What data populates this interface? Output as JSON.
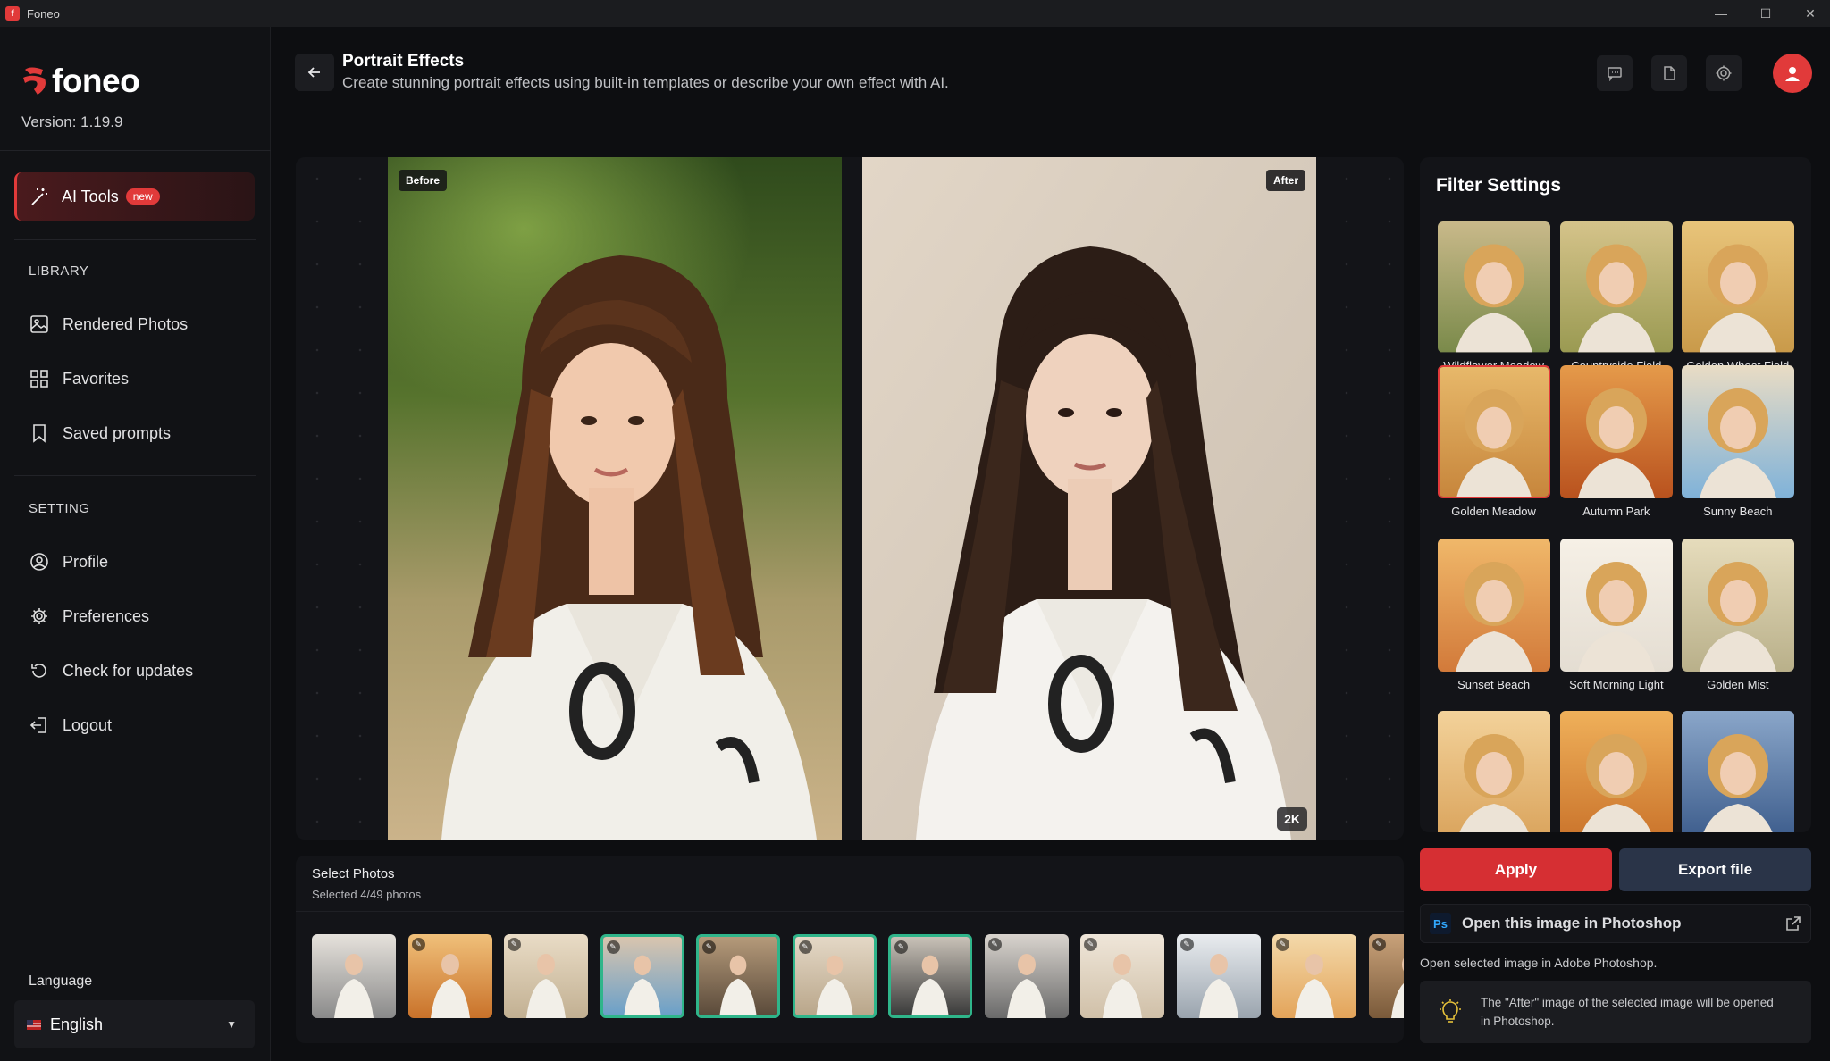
{
  "window": {
    "title": "Foneo"
  },
  "sidebar": {
    "logo_text": "foneo",
    "version": "Version: 1.19.9",
    "ai_tools": {
      "label": "AI Tools",
      "badge": "new"
    },
    "library_heading": "LIBRARY",
    "library_items": [
      {
        "label": "Rendered Photos",
        "icon": "image-icon"
      },
      {
        "label": "Favorites",
        "icon": "grid-icon"
      },
      {
        "label": "Saved prompts",
        "icon": "bookmark-icon"
      }
    ],
    "setting_heading": "SETTING",
    "setting_items": [
      {
        "label": "Profile",
        "icon": "user-circle-icon"
      },
      {
        "label": "Preferences",
        "icon": "gear-icon"
      },
      {
        "label": "Check for updates",
        "icon": "refresh-icon"
      },
      {
        "label": "Logout",
        "icon": "logout-icon"
      }
    ],
    "language_label": "Language",
    "language_value": "English"
  },
  "header": {
    "title": "Portrait Effects",
    "subtitle": "Create stunning portrait effects using built-in templates or describe your own effect with AI."
  },
  "compare": {
    "before_label": "Before",
    "after_label": "After",
    "resolution_badge": "2K"
  },
  "filters": {
    "heading": "Filter Settings",
    "items": [
      {
        "label": "Wildflower Meadow",
        "selected": false
      },
      {
        "label": "Countryside Field",
        "selected": false
      },
      {
        "label": "Golden Wheat Field",
        "selected": false
      },
      {
        "label": "Golden Meadow",
        "selected": true
      },
      {
        "label": "Autumn Park",
        "selected": false
      },
      {
        "label": "Sunny Beach",
        "selected": false
      },
      {
        "label": "Sunset Beach",
        "selected": false
      },
      {
        "label": "Soft Morning Light",
        "selected": false
      },
      {
        "label": "Golden Mist",
        "selected": false
      },
      {
        "label": "",
        "selected": false
      },
      {
        "label": "",
        "selected": false
      },
      {
        "label": "",
        "selected": false
      }
    ]
  },
  "actions": {
    "apply": "Apply",
    "export": "Export file",
    "photoshop_label": "Open this image in Photoshop",
    "photoshop_icon_text": "Ps",
    "photoshop_desc": "Open selected image in Adobe Photoshop.",
    "photoshop_info": "The \"After\" image of the selected image will be opened in Photoshop."
  },
  "select_photos": {
    "title": "Select Photos",
    "subtitle": "Selected 4/49 photos",
    "thumbnails": [
      {
        "selected": false
      },
      {
        "selected": false
      },
      {
        "selected": false
      },
      {
        "selected": true
      },
      {
        "selected": true
      },
      {
        "selected": true
      },
      {
        "selected": true
      },
      {
        "selected": false
      },
      {
        "selected": false
      },
      {
        "selected": false
      },
      {
        "selected": false
      },
      {
        "selected": false
      }
    ]
  },
  "colors": {
    "accent": "#e13a3a",
    "selected_border": "#2fb58a",
    "export_button": "#2a3448"
  }
}
